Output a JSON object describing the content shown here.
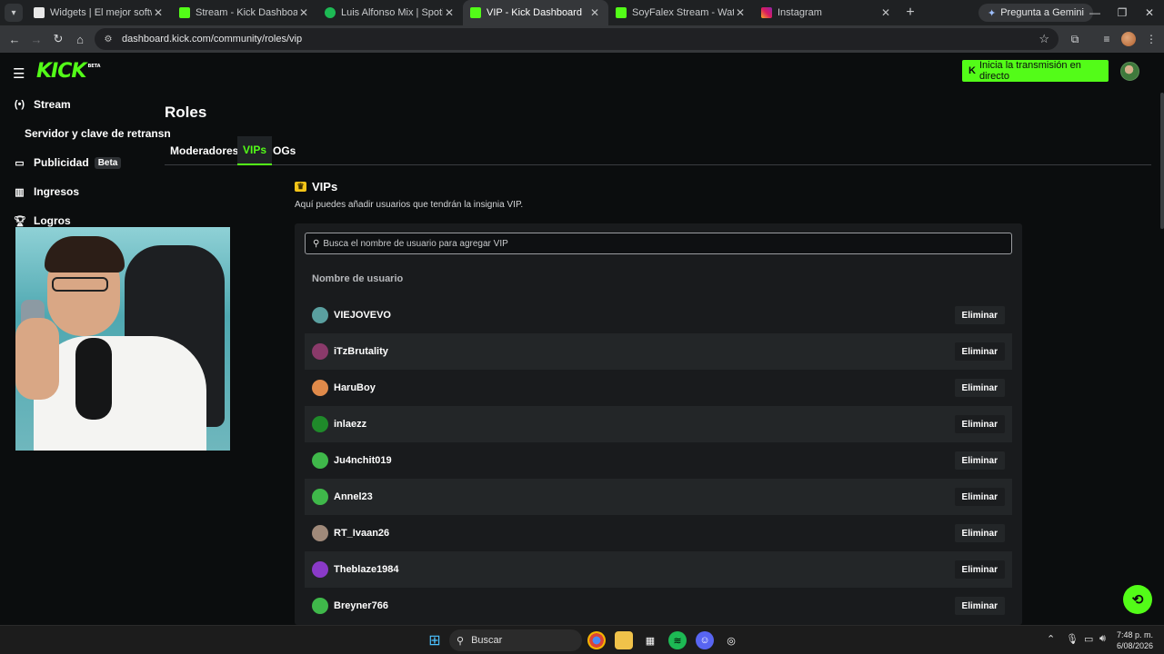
{
  "browser": {
    "tabs": [
      {
        "title": "Widgets | El mejor software pa",
        "favicon": "widgets-icon",
        "active": false
      },
      {
        "title": "Stream - Kick Dashboard",
        "favicon": "kick-icon",
        "active": false
      },
      {
        "title": "Luis Alfonso Mix | Spotify Playli",
        "favicon": "spotify-icon",
        "active": false
      },
      {
        "title": "VIP - Kick Dashboard",
        "favicon": "kick-icon",
        "active": true
      },
      {
        "title": "SoyFalex Stream - Watch Live o",
        "favicon": "kick-icon",
        "active": false
      },
      {
        "title": "Instagram",
        "favicon": "instagram-icon",
        "active": false
      }
    ],
    "gemini_label": "Pregunta a Gemini",
    "url": "dashboard.kick.com/community/roles/vip"
  },
  "header": {
    "logo_text": "KICK",
    "logo_badge": "BETA",
    "go_live_label": "Inicia la transmisión en directo",
    "brand_color": "#53fc18"
  },
  "sidebar": {
    "items": [
      {
        "label": "Stream",
        "icon": "broadcast-icon"
      },
      {
        "label": "Servidor y clave de retransn",
        "icon": ""
      },
      {
        "label": "Publicidad",
        "icon": "calendar-icon",
        "badge": "Beta"
      },
      {
        "label": "Ingresos",
        "icon": "chart-icon"
      },
      {
        "label": "Logros",
        "icon": "trophy-icon"
      }
    ]
  },
  "main": {
    "title": "Roles",
    "tabs": [
      {
        "label": "Moderadores",
        "active": false
      },
      {
        "label": "VIPs",
        "active": true
      },
      {
        "label": "OGs",
        "active": false
      }
    ],
    "section_title": "VIPs",
    "section_description": "Aquí puedes añadir usuarios que tendrán la insignia VIP.",
    "search_placeholder": "Busca el nombre de usuario para agregar VIP",
    "column_header": "Nombre de usuario",
    "remove_label": "Eliminar",
    "users": [
      {
        "name": "VIEJOVEVO",
        "avatar_color": "#5aa0a0"
      },
      {
        "name": "iTzBrutality",
        "avatar_color": "#8a3a6a"
      },
      {
        "name": "HaruBoy",
        "avatar_color": "#e08a4a"
      },
      {
        "name": "inlaezz",
        "avatar_color": "#1f8a2a"
      },
      {
        "name": "Ju4nchit019",
        "avatar_color": "#3fb84a"
      },
      {
        "name": "Annel23",
        "avatar_color": "#3fb84a"
      },
      {
        "name": "RT_Ivaan26",
        "avatar_color": "#a08a7a"
      },
      {
        "name": "Theblaze1984",
        "avatar_color": "#8a3ac8"
      },
      {
        "name": "Breyner766",
        "avatar_color": "#3fb84a"
      }
    ]
  },
  "taskbar": {
    "search_label": "Buscar",
    "time": "7:48 p. m.",
    "date": "6/08/2026"
  }
}
